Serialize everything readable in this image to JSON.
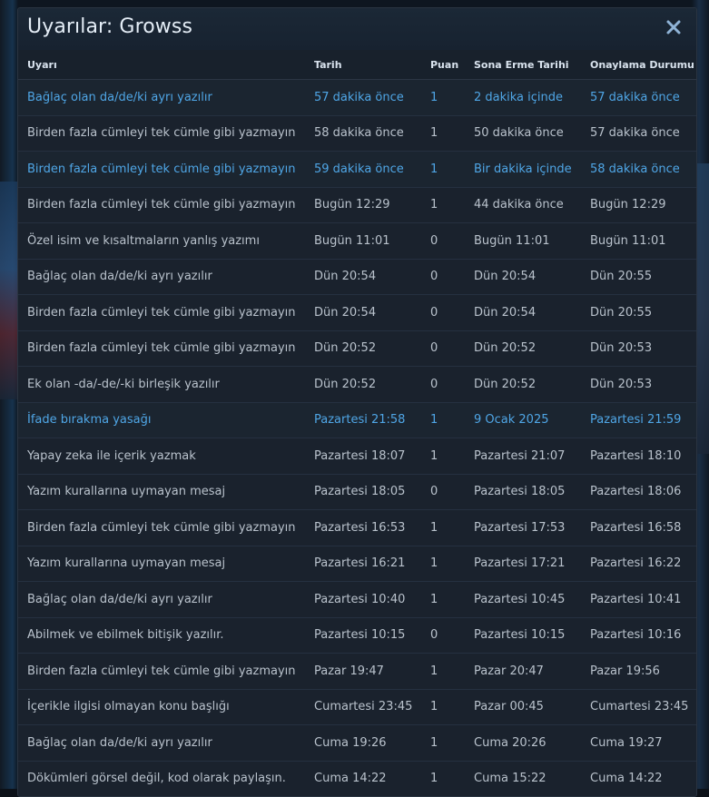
{
  "dialog": {
    "title": "Uyarılar: Growss",
    "close_icon": "close-icon",
    "accent_color": "#4fa6e6"
  },
  "table": {
    "columns": [
      "Uyarı",
      "Tarih",
      "Puan",
      "Sona Erme Tarihi",
      "Onaylama Durumu"
    ],
    "rows": [
      {
        "unread": true,
        "cells": [
          "Bağlaç olan da/de/ki ayrı yazılır",
          "57 dakika önce",
          "1",
          "2 dakika içinde",
          "57 dakika önce"
        ]
      },
      {
        "unread": false,
        "cells": [
          "Birden fazla cümleyi tek cümle gibi yazmayın",
          "58 dakika önce",
          "1",
          "50 dakika önce",
          "57 dakika önce"
        ]
      },
      {
        "unread": true,
        "cells": [
          "Birden fazla cümleyi tek cümle gibi yazmayın",
          "59 dakika önce",
          "1",
          "Bir dakika içinde",
          "58 dakika önce"
        ]
      },
      {
        "unread": false,
        "cells": [
          "Birden fazla cümleyi tek cümle gibi yazmayın",
          "Bugün 12:29",
          "1",
          "44 dakika önce",
          "Bugün 12:29"
        ]
      },
      {
        "unread": false,
        "cells": [
          "Özel isim ve kısaltmaların yanlış yazımı",
          "Bugün 11:01",
          "0",
          "Bugün 11:01",
          "Bugün 11:01"
        ]
      },
      {
        "unread": false,
        "cells": [
          "Bağlaç olan da/de/ki ayrı yazılır",
          "Dün 20:54",
          "0",
          "Dün 20:54",
          "Dün 20:55"
        ]
      },
      {
        "unread": false,
        "cells": [
          "Birden fazla cümleyi tek cümle gibi yazmayın",
          "Dün 20:54",
          "0",
          "Dün 20:54",
          "Dün 20:55"
        ]
      },
      {
        "unread": false,
        "cells": [
          "Birden fazla cümleyi tek cümle gibi yazmayın",
          "Dün 20:52",
          "0",
          "Dün 20:52",
          "Dün 20:53"
        ]
      },
      {
        "unread": false,
        "cells": [
          "Ek olan -da/-de/-ki birleşik yazılır",
          "Dün 20:52",
          "0",
          "Dün 20:52",
          "Dün 20:53"
        ]
      },
      {
        "unread": true,
        "cells": [
          "İfade bırakma yasağı",
          "Pazartesi 21:58",
          "1",
          "9 Ocak 2025",
          "Pazartesi 21:59"
        ]
      },
      {
        "unread": false,
        "cells": [
          "Yapay zeka ile içerik yazmak",
          "Pazartesi 18:07",
          "1",
          "Pazartesi 21:07",
          "Pazartesi 18:10"
        ]
      },
      {
        "unread": false,
        "cells": [
          "Yazım kurallarına uymayan mesaj",
          "Pazartesi 18:05",
          "0",
          "Pazartesi 18:05",
          "Pazartesi 18:06"
        ]
      },
      {
        "unread": false,
        "cells": [
          "Birden fazla cümleyi tek cümle gibi yazmayın",
          "Pazartesi 16:53",
          "1",
          "Pazartesi 17:53",
          "Pazartesi 16:58"
        ]
      },
      {
        "unread": false,
        "cells": [
          "Yazım kurallarına uymayan mesaj",
          "Pazartesi 16:21",
          "1",
          "Pazartesi 17:21",
          "Pazartesi 16:22"
        ]
      },
      {
        "unread": false,
        "cells": [
          "Bağlaç olan da/de/ki ayrı yazılır",
          "Pazartesi 10:40",
          "1",
          "Pazartesi 10:45",
          "Pazartesi 10:41"
        ]
      },
      {
        "unread": false,
        "cells": [
          "Abilmek ve ebilmek bitişik yazılır.",
          "Pazartesi 10:15",
          "0",
          "Pazartesi 10:15",
          "Pazartesi 10:16"
        ]
      },
      {
        "unread": false,
        "cells": [
          "Birden fazla cümleyi tek cümle gibi yazmayın",
          "Pazar 19:47",
          "1",
          "Pazar 20:47",
          "Pazar 19:56"
        ]
      },
      {
        "unread": false,
        "cells": [
          "İçerikle ilgisi olmayan konu başlığı",
          "Cumartesi 23:45",
          "1",
          "Pazar 00:45",
          "Cumartesi 23:45"
        ]
      },
      {
        "unread": false,
        "cells": [
          "Bağlaç olan da/de/ki ayrı yazılır",
          "Cuma 19:26",
          "1",
          "Cuma 20:26",
          "Cuma 19:27"
        ]
      },
      {
        "unread": false,
        "cells": [
          "Dökümleri görsel değil, kod olarak paylaşın.",
          "Cuma 14:22",
          "1",
          "Cuma 15:22",
          "Cuma 14:22"
        ]
      }
    ]
  }
}
